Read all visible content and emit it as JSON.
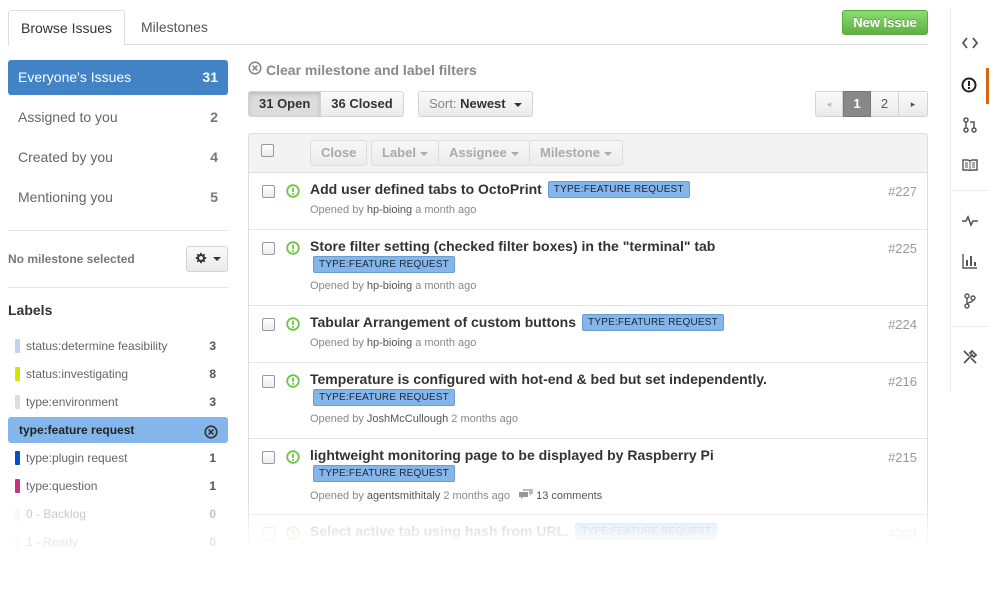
{
  "tabs": {
    "browse": "Browse Issues",
    "milestones": "Milestones"
  },
  "new_issue_label": "New Issue",
  "filters": [
    {
      "label": "Everyone's Issues",
      "count": "31"
    },
    {
      "label": "Assigned to you",
      "count": "2"
    },
    {
      "label": "Created by you",
      "count": "4"
    },
    {
      "label": "Mentioning you",
      "count": "5"
    }
  ],
  "milestone_status": "No milestone selected",
  "labels_heading": "Labels",
  "labels": [
    {
      "name": "status:determine feasibility",
      "count": "3",
      "color": "#bfd4f2"
    },
    {
      "name": "status:investigating",
      "count": "8",
      "color": "#d4e10b"
    },
    {
      "name": "type:environment",
      "count": "3",
      "color": "#dddddd"
    },
    {
      "name": "type:feature request",
      "count": "",
      "color": "#84b6eb"
    },
    {
      "name": "type:plugin request",
      "count": "1",
      "color": "#0052cc"
    },
    {
      "name": "type:question",
      "count": "1",
      "color": "#cc317c"
    },
    {
      "name": "0 - Backlog",
      "count": "0",
      "color": "#ededed"
    },
    {
      "name": "1 - Ready",
      "count": "0",
      "color": "#ededed"
    }
  ],
  "clear_filters": "Clear milestone and label filters",
  "state": {
    "open": "31 Open",
    "closed": "36 Closed"
  },
  "sort": {
    "prefix": "Sort:",
    "value": "Newest"
  },
  "pagination": {
    "prev": "◂",
    "page1": "1",
    "page2": "2",
    "next": "▸"
  },
  "toolbar": {
    "close": "Close",
    "label": "Label",
    "assignee": "Assignee",
    "milestone": "Milestone"
  },
  "issues": [
    {
      "title": "Add user defined tabs to OctoPrint",
      "tag": "TYPE:FEATURE REQUEST",
      "opened": "Opened by",
      "author": "hp-bioing",
      "time": "a month ago",
      "comments": "",
      "number": "#227"
    },
    {
      "title": "Store filter setting (checked filter boxes) in the \"terminal\" tab",
      "tag": "TYPE:FEATURE REQUEST",
      "opened": "Opened by",
      "author": "hp-bioing",
      "time": "a month ago",
      "comments": "",
      "number": "#225"
    },
    {
      "title": "Tabular Arrangement of custom buttons",
      "tag": "TYPE:FEATURE REQUEST",
      "opened": "Opened by",
      "author": "hp-bioing",
      "time": "a month ago",
      "comments": "",
      "number": "#224"
    },
    {
      "title": "Temperature is configured with hot-end & bed but set independently.",
      "tag": "TYPE:FEATURE REQUEST",
      "opened": "Opened by",
      "author": "JoshMcCullough",
      "time": "2 months ago",
      "comments": "",
      "number": "#216"
    },
    {
      "title": "lightweight monitoring page to be displayed by Raspberry Pi",
      "tag": "TYPE:FEATURE REQUEST",
      "opened": "Opened by",
      "author": "agentsmithitaly",
      "time": "2 months ago",
      "comments": "13 comments",
      "number": "#215"
    },
    {
      "title": "Select active tab using hash from URL.",
      "tag": "TYPE:FEATURE REQUEST",
      "opened": "",
      "author": "",
      "time": "",
      "comments": "",
      "number": "#203"
    }
  ],
  "sidebar_icons": [
    "code-icon",
    "issues-icon",
    "pull-request-icon",
    "wiki-icon",
    "pulse-icon",
    "graphs-icon",
    "network-icon",
    "settings-icon"
  ]
}
